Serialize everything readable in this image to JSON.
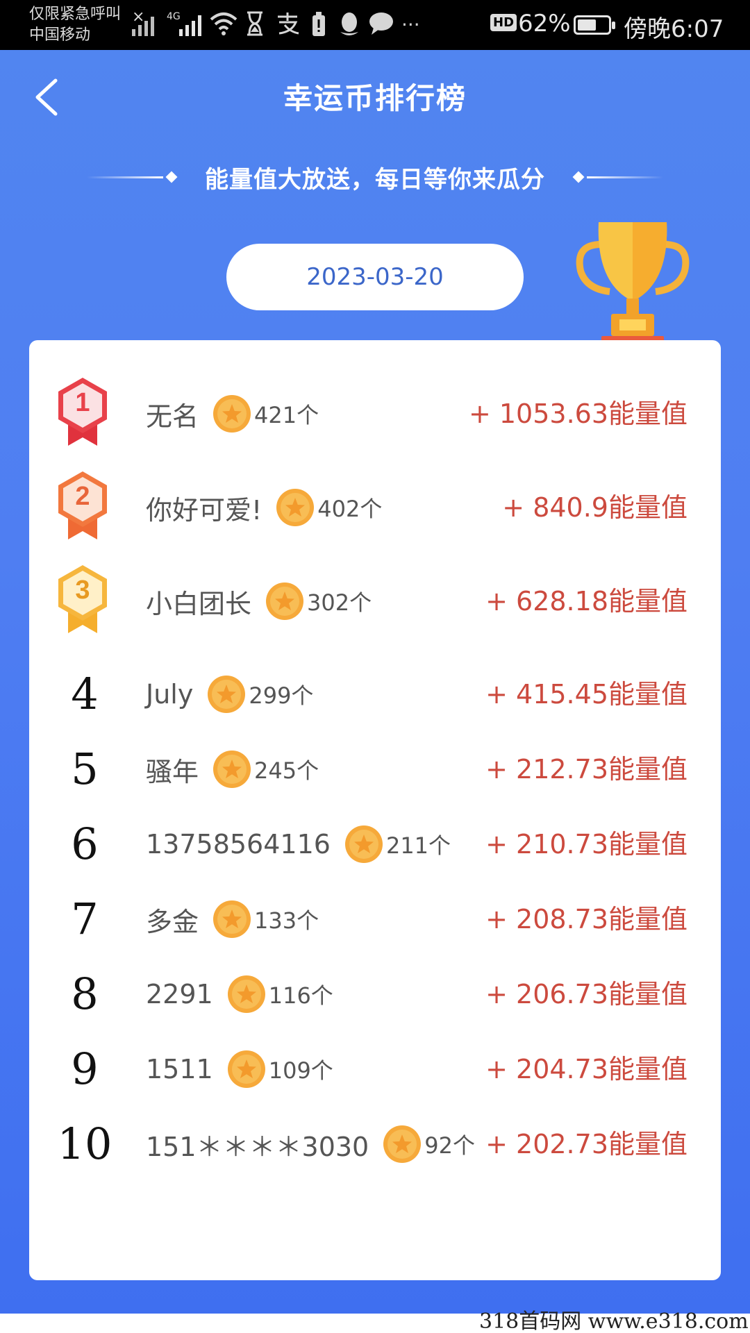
{
  "status_bar": {
    "carrier_line1": "仅限紧急呼叫",
    "carrier_line2": "中国移动",
    "close_symbol": "×",
    "network_label": "4G",
    "hd_label": "HD",
    "battery_percent": "62%",
    "battery_level": 0.62,
    "time": "傍晚6:07",
    "icons": [
      "signal-icon",
      "signal-4g-icon",
      "wifi-icon",
      "hourglass-icon",
      "alipay-icon",
      "battery-alert-icon",
      "qq-icon",
      "chat-icon",
      "more-icon"
    ]
  },
  "header": {
    "title": "幸运币排行榜",
    "back_icon": "chevron-left-icon"
  },
  "slogan": "能量值大放送，每日等你来瓜分",
  "date": "2023-03-20",
  "trophy_icon": "trophy-icon",
  "colors": {
    "bg_blue_top": "#5185f0",
    "bg_blue_bottom": "#3f6ff0",
    "energy_red": "#cc4a3e",
    "date_text": "#3b66c9",
    "medal_gold": "#f6b63d",
    "medal_silver_red": "#e8414a",
    "medal_orange": "#f2783e"
  },
  "ranking": [
    {
      "rank": "1",
      "medal": "medal-1",
      "name": "无名",
      "coins": "421个",
      "energy": "+ 1053.63能量值"
    },
    {
      "rank": "2",
      "medal": "medal-2",
      "name": "你好可爱!",
      "coins": "402个",
      "energy": "+ 840.9能量值"
    },
    {
      "rank": "3",
      "medal": "medal-3",
      "name": "小白团长",
      "coins": "302个",
      "energy": "+ 628.18能量值"
    },
    {
      "rank": "4",
      "name": "July",
      "coins": "299个",
      "energy": "+ 415.45能量值"
    },
    {
      "rank": "5",
      "name": "骚年",
      "coins": "245个",
      "energy": "+ 212.73能量值"
    },
    {
      "rank": "6",
      "name": "13758564116",
      "coins": "211个",
      "energy": "+ 210.73能量值"
    },
    {
      "rank": "7",
      "name": "多金",
      "coins": "133个",
      "energy": "+ 208.73能量值"
    },
    {
      "rank": "8",
      "name": "2291",
      "coins": "116个",
      "energy": "+ 206.73能量值"
    },
    {
      "rank": "9",
      "name": "1511",
      "coins": "109个",
      "energy": "+ 204.73能量值"
    },
    {
      "rank": "10",
      "name": "151＊＊＊＊3030",
      "coins": "92个",
      "energy": "+ 202.73能量值"
    }
  ],
  "watermark": "318首码网  www.e318.com"
}
